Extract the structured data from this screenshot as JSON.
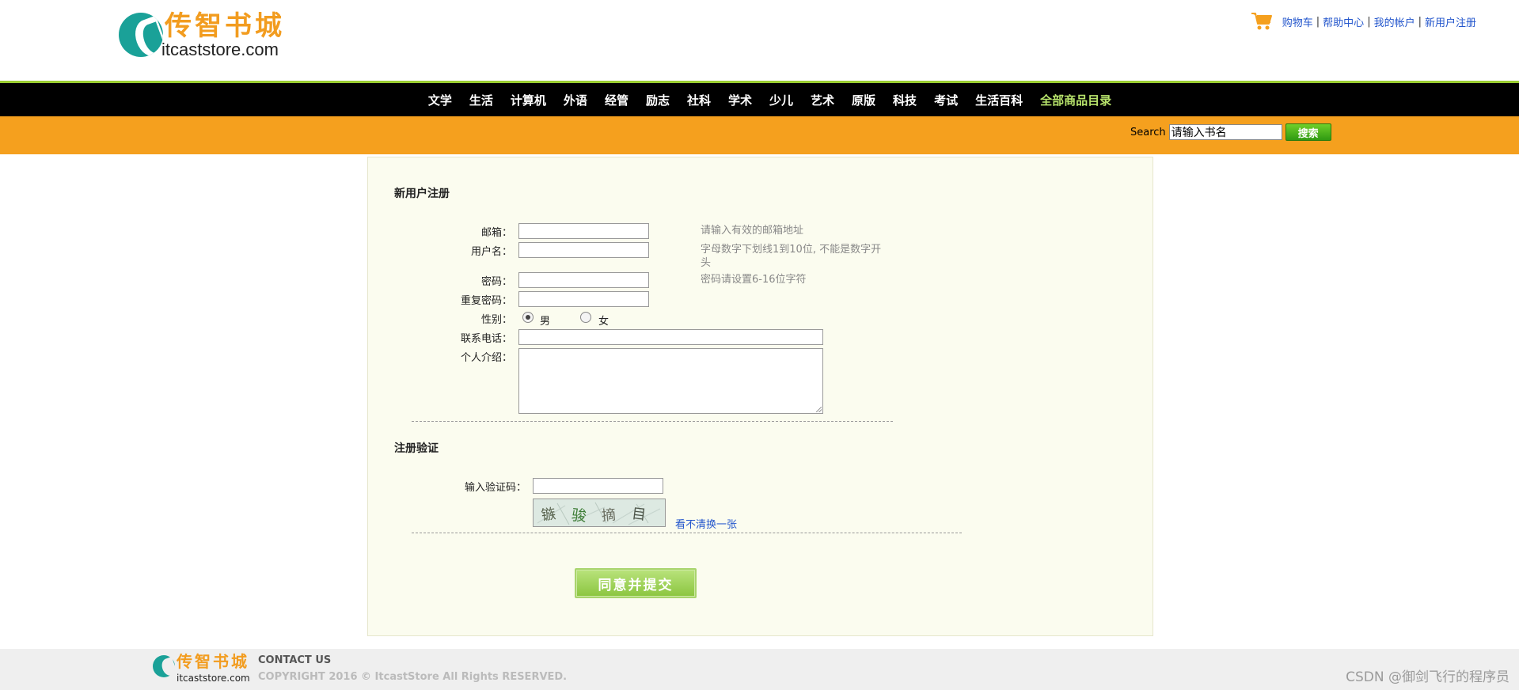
{
  "header": {
    "logo_cn": "传智书城",
    "logo_en": "itcaststore.com",
    "links": [
      "购物车",
      "帮助中心",
      "我的帐户",
      "新用户注册"
    ],
    "separator": "|",
    "cart_icon": "shopping-cart-icon"
  },
  "nav": {
    "items": [
      "文学",
      "生活",
      "计算机",
      "外语",
      "经管",
      "励志",
      "社科",
      "学术",
      "少儿",
      "艺术",
      "原版",
      "科技",
      "考试",
      "生活百科"
    ],
    "all_label": "全部商品目录"
  },
  "search": {
    "label": "Search",
    "value": "请输入书名",
    "button": "搜索"
  },
  "form": {
    "title": "新用户注册",
    "email_label": "邮箱：",
    "email_hint": "请输入有效的邮箱地址",
    "username_label": "用户名：",
    "username_hint": "字母数字下划线1到10位, 不能是数字开头",
    "password_label": "密码：",
    "password_hint": "密码请设置6-16位字符",
    "repassword_label": "重复密码：",
    "gender_label": "性别：",
    "gender_male": "男",
    "gender_female": "女",
    "gender_selected": "男",
    "phone_label": "联系电话：",
    "intro_label": "个人介绍："
  },
  "verify": {
    "title": "注册验证",
    "code_label": "输入验证码：",
    "captcha_text": "镞 骏 摘 目",
    "refresh_link": "看不清换一张"
  },
  "submit": {
    "label": "同意并提交"
  },
  "footer": {
    "logo_cn": "传智书城",
    "logo_en": "itcaststore.com",
    "contact": "CONTACT US",
    "copyright": "COPYRIGHT 2016 © ItcastStore All Rights RESERVED.",
    "watermark": "CSDN @御剑飞行的程序员"
  },
  "colors": {
    "accent_orange": "#f5a01e",
    "nav_bg": "#000000",
    "nav_highlight": "#b7e36b",
    "logo_teal": "#1aa198",
    "logo_orange": "#f29c1f",
    "link_blue": "#2255cc",
    "panel_bg": "#fbfcef"
  }
}
